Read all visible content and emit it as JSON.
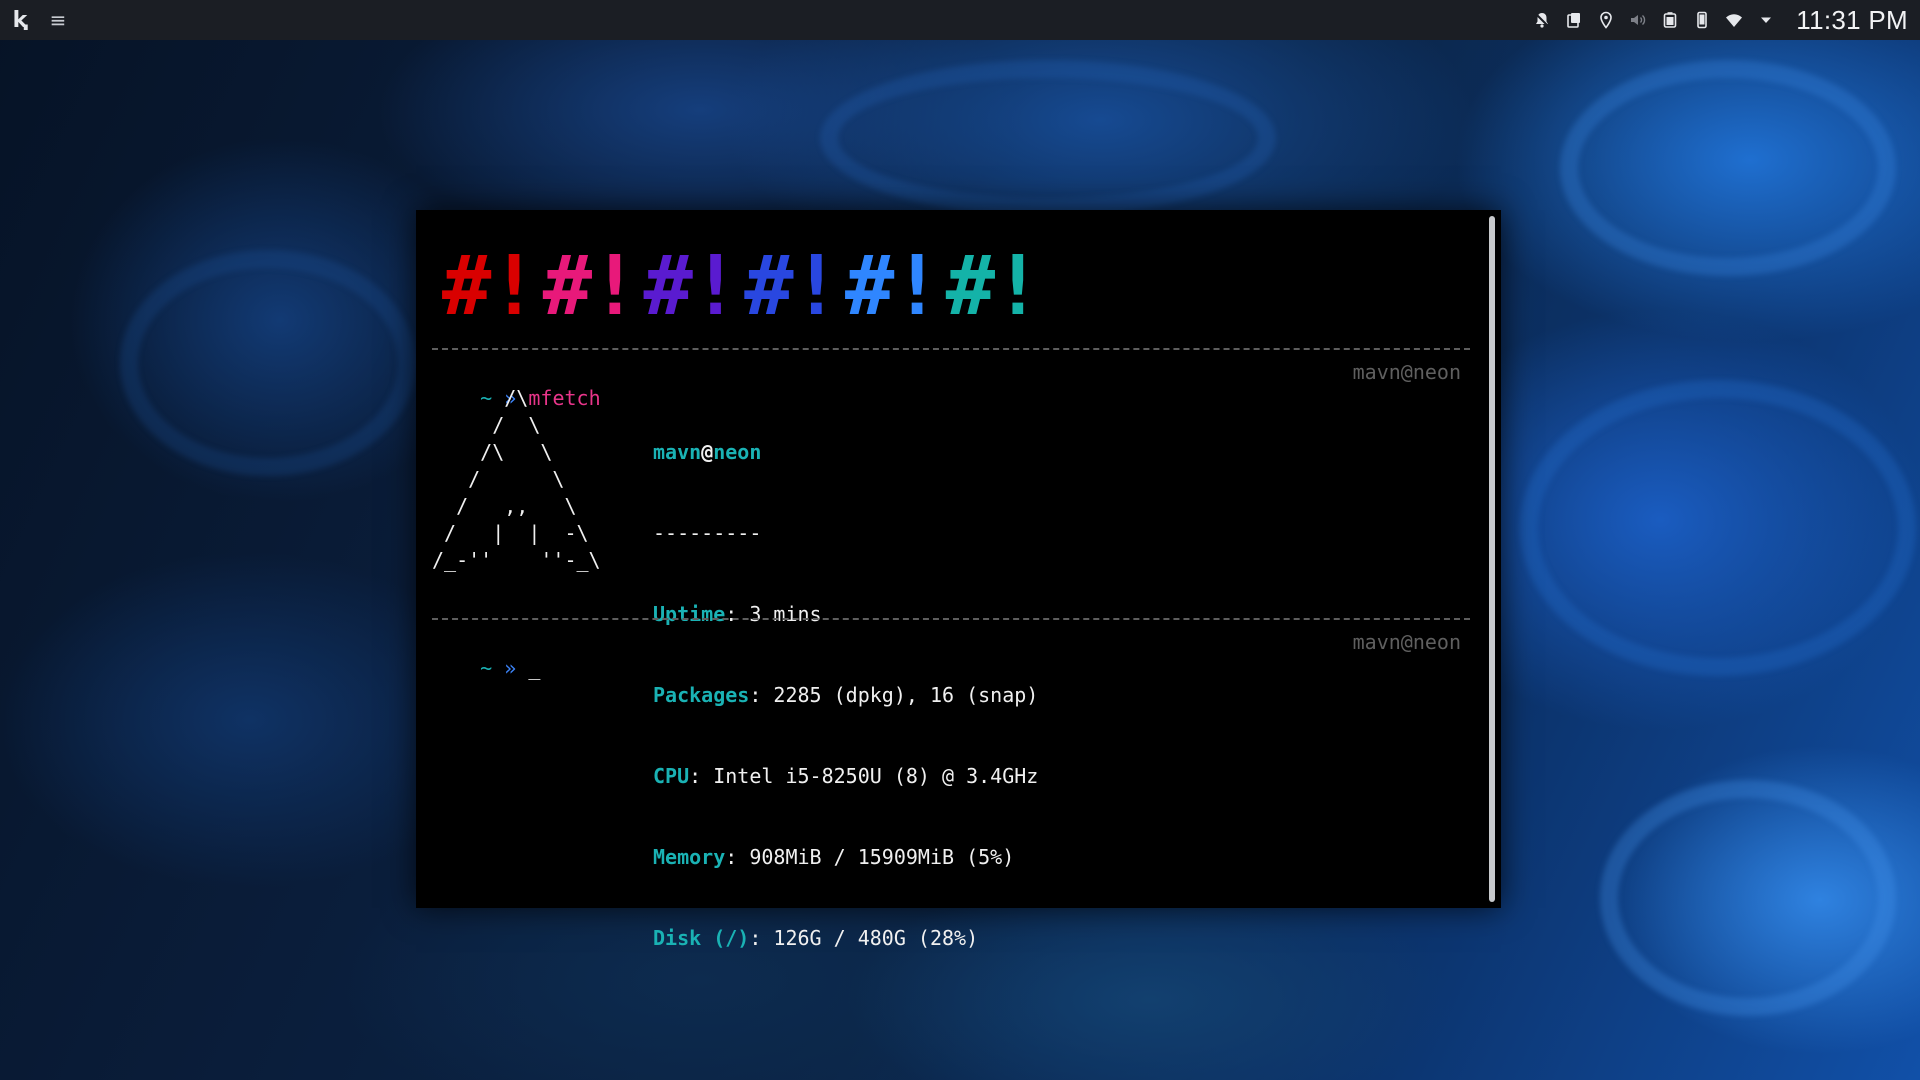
{
  "panel": {
    "launcher_glyph": "ⱪ",
    "menu_glyph": "≡",
    "clock": "11:31 PM",
    "tray_icons": [
      "notification-bell-icon",
      "clipboard-icon",
      "location-icon",
      "volume-icon",
      "battery-icon",
      "phone-icon",
      "wifi-icon",
      "tray-expand-icon"
    ]
  },
  "terminal": {
    "banner": [
      {
        "text": "#!",
        "color": "#d90000"
      },
      {
        "text": "#!",
        "color": "#e8197a"
      },
      {
        "text": "#!",
        "color": "#5a1bd0"
      },
      {
        "text": "#!",
        "color": "#2947e0"
      },
      {
        "text": "#!",
        "color": "#2f86ff"
      },
      {
        "text": "#!",
        "color": "#14b3a8"
      }
    ],
    "prompt1": {
      "tilde": "~",
      "arrow": "»",
      "command": "mfetch",
      "host": "mavn@neon"
    },
    "ascii_art": "      /\\\n     /  \\\n    /\\   \\\n   /      \\\n  /   ,,   \\\n /   |  |  -\\\n/_-''    ''-_\\",
    "info": {
      "title_user": "mavn",
      "title_at": "@",
      "title_host": "neon",
      "separator": "---------",
      "rows": [
        {
          "key": "Uptime",
          "value": ": 3 mins"
        },
        {
          "key": "Packages",
          "value": ": 2285 (dpkg), 16 (snap)"
        },
        {
          "key": "CPU",
          "value": ": Intel i5-8250U (8) @ 3.4GHz"
        },
        {
          "key": "Memory",
          "value": ": 908MiB / 15909MiB (5%)"
        },
        {
          "key": "Disk (/)",
          "value": ": 126G / 480G (28%)"
        }
      ]
    },
    "prompt2": {
      "tilde": "~",
      "arrow": "»",
      "cursor": "_",
      "host": "mavn@neon"
    }
  },
  "colors": {
    "panel_bg": "#1b1e24",
    "terminal_bg": "#000000",
    "accent_cyan": "#1ab2b4",
    "prompt_blue": "#3b82f6",
    "command_pink": "#e8358a"
  }
}
